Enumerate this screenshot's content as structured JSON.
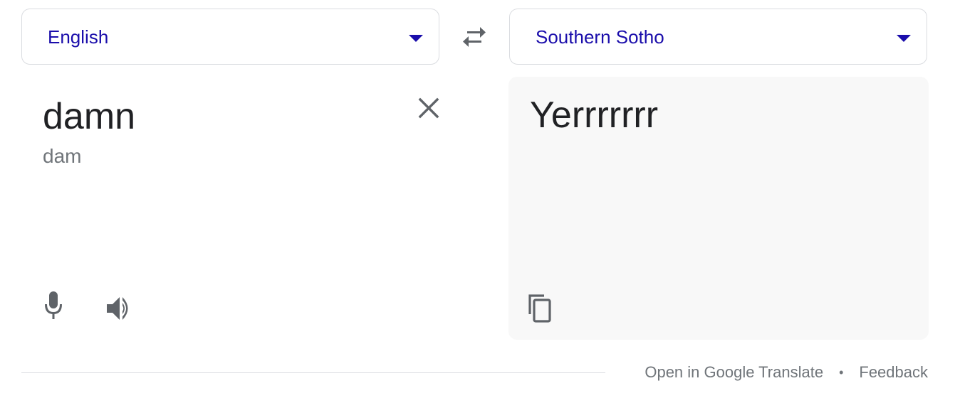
{
  "source_language": {
    "label": "English",
    "icon": "chevron-down-icon"
  },
  "target_language": {
    "label": "Southern Sotho",
    "icon": "chevron-down-icon"
  },
  "swap": {
    "icon": "swap-arrows-icon"
  },
  "source": {
    "text": "damn",
    "transliteration": "dam",
    "clear_icon": "close-icon",
    "mic_icon": "microphone-icon",
    "listen_icon": "speaker-icon"
  },
  "target": {
    "text": "Yerrrrrrr",
    "copy_icon": "copy-icon"
  },
  "footer": {
    "open_link": "Open in Google Translate",
    "separator": "•",
    "feedback_link": "Feedback"
  },
  "colors": {
    "accent": "#1a0dab",
    "icon": "#5f6368",
    "muted_text": "#70757a",
    "border": "#dadce0",
    "target_bg": "#f8f8f8"
  }
}
